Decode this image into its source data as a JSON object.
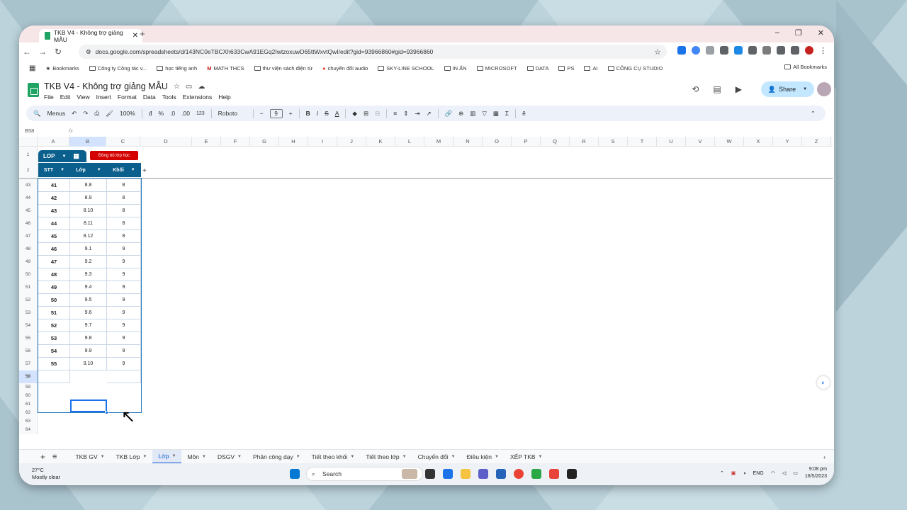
{
  "browser": {
    "tab_title": "TKB V4 - Không trợ giảng MẪU",
    "url": "docs.google.com/spreadsheets/d/143NC0eTBCXh633CwA91EGq2IwtzoxuwD65ttWxvtQwI/edit?gid=93966860#gid=93966860",
    "bookmarks": [
      "Bookmarks",
      "Công ty Công tác v...",
      "học tiếng anh",
      "MATH THCS",
      "thư viện sách điện tử",
      "chuyển đổi audio",
      "SKY-LINE SCHOOL",
      "IN ẤN",
      "MICROSOFT",
      "DATA",
      "PS",
      "AI",
      "CÔNG CỤ STUDIO"
    ],
    "all_bookmarks": "All Bookmarks"
  },
  "doc": {
    "title": "TKB V4 - Không trợ giảng MẪU",
    "menus": [
      "File",
      "Edit",
      "View",
      "Insert",
      "Format",
      "Data",
      "Tools",
      "Extensions",
      "Help"
    ],
    "share_label": "Share"
  },
  "toolbar": {
    "menus_label": "Menus",
    "zoom": "100%",
    "currency": "đ",
    "percent": "%",
    "dec_less": ".0",
    "dec_more": ".00",
    "numfmt": "123",
    "font": "Roboto",
    "font_size": "9"
  },
  "formula_bar": {
    "cell_ref": "B58",
    "fx": "fx"
  },
  "grid": {
    "columns": [
      "A",
      "B",
      "C",
      "D",
      "E",
      "F",
      "G",
      "H",
      "I",
      "J",
      "K",
      "L",
      "M",
      "N",
      "O",
      "P",
      "Q",
      "R",
      "S",
      "T",
      "U",
      "V",
      "W",
      "X",
      "Y",
      "Z"
    ],
    "table_chip": "LOP",
    "sync_button": "Đồng bộ lớp học",
    "headers": [
      "STT",
      "Lớp",
      "Khối"
    ],
    "rows": [
      {
        "r": "43",
        "stt": "41",
        "lop": "8.8",
        "khoi": "8"
      },
      {
        "r": "44",
        "stt": "42",
        "lop": "8.9",
        "khoi": "8"
      },
      {
        "r": "45",
        "stt": "43",
        "lop": "8.10",
        "khoi": "8"
      },
      {
        "r": "46",
        "stt": "44",
        "lop": "8.11",
        "khoi": "8"
      },
      {
        "r": "47",
        "stt": "45",
        "lop": "8.12",
        "khoi": "8"
      },
      {
        "r": "48",
        "stt": "46",
        "lop": "9.1",
        "khoi": "9"
      },
      {
        "r": "49",
        "stt": "47",
        "lop": "9.2",
        "khoi": "9"
      },
      {
        "r": "50",
        "stt": "48",
        "lop": "9.3",
        "khoi": "9"
      },
      {
        "r": "51",
        "stt": "49",
        "lop": "9.4",
        "khoi": "9"
      },
      {
        "r": "52",
        "stt": "50",
        "lop": "9.5",
        "khoi": "9"
      },
      {
        "r": "53",
        "stt": "51",
        "lop": "9.6",
        "khoi": "9"
      },
      {
        "r": "54",
        "stt": "52",
        "lop": "9.7",
        "khoi": "9"
      },
      {
        "r": "55",
        "stt": "53",
        "lop": "9.8",
        "khoi": "9"
      },
      {
        "r": "56",
        "stt": "54",
        "lop": "9.9",
        "khoi": "9"
      },
      {
        "r": "57",
        "stt": "55",
        "lop": "9.10",
        "khoi": "9"
      }
    ],
    "empty_rows": [
      "58",
      "59",
      "60",
      "61",
      "62",
      "63",
      "64"
    ]
  },
  "sheet_tabs": [
    "TKB GV",
    "TKB Lớp",
    "Lớp",
    "Môn",
    "DSGV",
    "Phân công dạy",
    "Tiết theo khối",
    "Tiết theo lớp",
    "Chuyển đổi",
    "Điều kiện",
    "XẾP TKB"
  ],
  "active_sheet": "Lớp",
  "taskbar": {
    "weather_temp": "27°C",
    "weather_desc": "Mostly clear",
    "search_placeholder": "Search",
    "lang": "ENG",
    "time": "9:08 pm",
    "date": "16/5/2023"
  }
}
